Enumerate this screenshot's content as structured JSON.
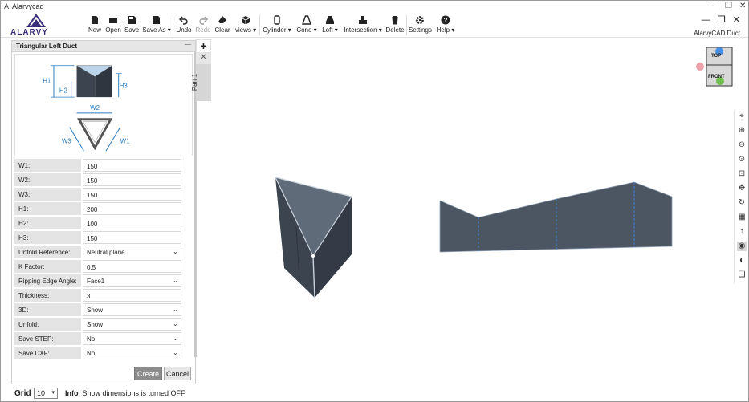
{
  "window": {
    "title": "Alarvycad",
    "product": "AlarvyCAD Duct",
    "logo_text": "ALARVY"
  },
  "toolbar": {
    "new": "New",
    "open": "Open",
    "save": "Save",
    "save_as": "Save As",
    "undo": "Undo",
    "redo": "Redo",
    "clear": "Clear",
    "views": "views",
    "cylinder": "Cylinder",
    "cone": "Cone",
    "loft": "Loft",
    "intersection": "Intersection",
    "delete": "Delete",
    "settings": "Settings",
    "help": "Help"
  },
  "panel": {
    "title": "Triangular Loft Duct",
    "diagram_labels": {
      "h1": "H1",
      "h2": "H2",
      "h3": "H3",
      "w1": "W1",
      "w2": "W2",
      "w3": "W3"
    },
    "fields": [
      {
        "label": "W1:",
        "value": "150"
      },
      {
        "label": "W2:",
        "value": "150"
      },
      {
        "label": "W3:",
        "value": "150"
      },
      {
        "label": "H1:",
        "value": "200"
      },
      {
        "label": "H2:",
        "value": "100"
      },
      {
        "label": "H3:",
        "value": "150"
      },
      {
        "label": "Unfold Reference:",
        "value": "Neutral plane"
      },
      {
        "label": "K Factor:",
        "value": "0.5"
      },
      {
        "label": "Ripping Edge Angle:",
        "value": "Face1"
      },
      {
        "label": "Thickness:",
        "value": "3"
      },
      {
        "label": "3D:",
        "value": "Show"
      },
      {
        "label": "Unfold:",
        "value": "Show"
      },
      {
        "label": "Save STEP:",
        "value": "No"
      },
      {
        "label": "Save DXF:",
        "value": "No"
      }
    ],
    "create": "Create",
    "cancel": "Cancel"
  },
  "tabs": {
    "part": "Part 1"
  },
  "viewcube": {
    "top": "TOP",
    "front": "FRONT"
  },
  "status": {
    "grid_label": "Grid :",
    "grid_value": "10",
    "info_label": "Info",
    "info_text": ": Show dimensions is turned OFF"
  },
  "colors": {
    "model_dark": "#3c4450",
    "model_face": "#5f6b78",
    "accent_blue": "#2a7bbd"
  }
}
